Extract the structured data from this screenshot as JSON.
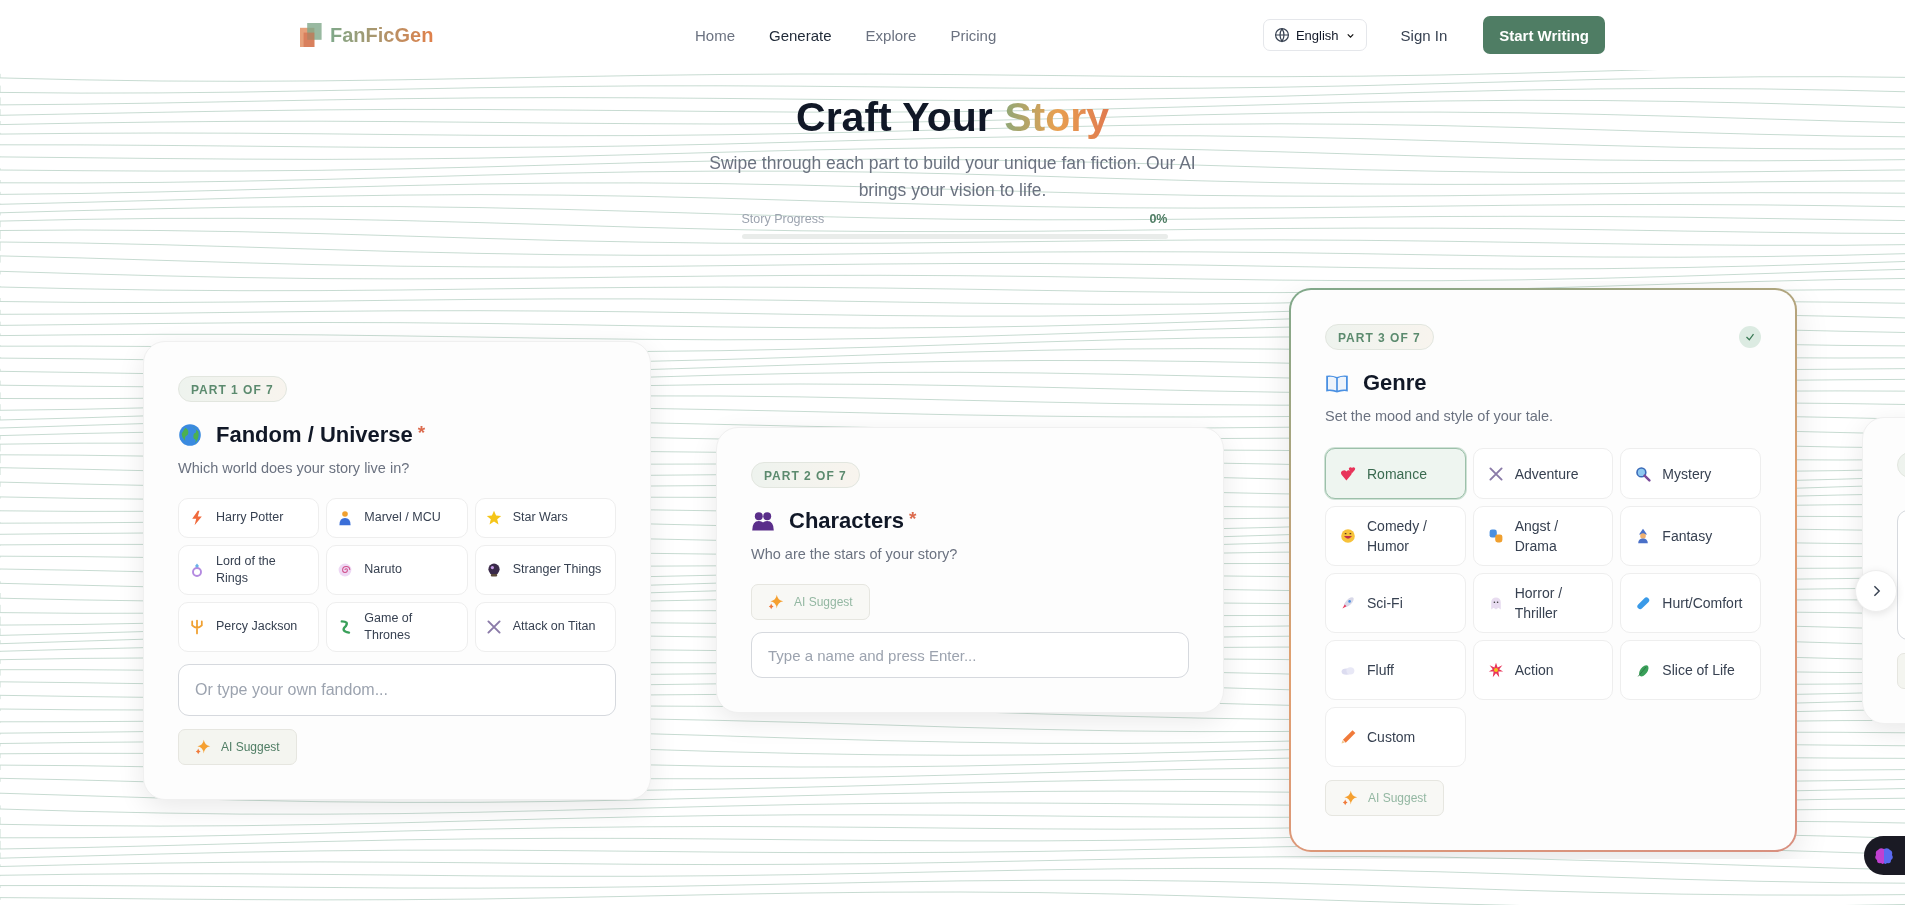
{
  "header": {
    "logo": "FanFicGen",
    "nav": [
      {
        "label": "Home",
        "selected": false
      },
      {
        "label": "Generate",
        "selected": true
      },
      {
        "label": "Explore",
        "selected": false
      },
      {
        "label": "Pricing",
        "selected": false
      }
    ],
    "language": "English",
    "sign_in": "Sign In",
    "cta": "Start Writing"
  },
  "hero": {
    "title": "Craft Your **Story**",
    "subtitle": "Swipe through each part to build your unique fan fiction. Our AI brings your vision to life.",
    "progress_label": "Story Progress",
    "progress_value": "0%",
    "level": 0
  },
  "cards": [
    {
      "part": "PART 1 OF 7",
      "title": "Fandom / Universe",
      "required_mark": "*",
      "active": false,
      "description": "Which world does your story live in?",
      "blocks": [
        {
          "kind": "options",
          "items": [
            {
              "label": "Harry Potter",
              "selected": false
            },
            {
              "label": "Marvel / MCU",
              "selected": false
            },
            {
              "label": "Star Wars",
              "selected": false
            },
            {
              "label": "Lord of the Rings",
              "selected": false
            },
            {
              "label": "Naruto",
              "selected": false
            },
            {
              "label": "Stranger Things",
              "selected": false
            },
            {
              "label": "Percy Jackson",
              "selected": false
            },
            {
              "label": "Game of Thrones",
              "selected": false
            },
            {
              "label": "Attack on Titan",
              "selected": false
            }
          ]
        },
        {
          "kind": "input",
          "placeholder": "Or type your own fandom..."
        },
        {
          "kind": "ai",
          "label": "AI Suggest",
          "disabled": false
        }
      ]
    },
    {
      "part": "PART 2 OF 7",
      "title": "Characters",
      "required_mark": "*",
      "active": false,
      "description": "Who are the stars of your story?",
      "blocks": [
        {
          "kind": "ai",
          "label": "AI Suggest",
          "disabled": true
        },
        {
          "kind": "input",
          "placeholder": "Type a name and press Enter..."
        }
      ]
    },
    {
      "part": "PART 3 OF 7",
      "title": "Genre",
      "completed": true,
      "active": true,
      "description": "Set the mood and style of your tale.",
      "blocks": [
        {
          "kind": "options",
          "items": [
            {
              "label": "Romance",
              "selected": true
            },
            {
              "label": "Adventure",
              "selected": false
            },
            {
              "label": "Mystery",
              "selected": false
            },
            {
              "label": "Comedy / Humor",
              "selected": false
            },
            {
              "label": "Angst / Drama",
              "selected": false
            },
            {
              "label": "Fantasy",
              "selected": false
            },
            {
              "label": "Sci-Fi",
              "selected": false
            },
            {
              "label": "Horror / Thriller",
              "selected": false
            },
            {
              "label": "Hurt/Comfort",
              "selected": false
            },
            {
              "label": "Fluff",
              "selected": false
            },
            {
              "label": "Action",
              "selected": false
            },
            {
              "label": "Slice of Life",
              "selected": false
            },
            {
              "label": "Custom",
              "selected": false
            }
          ]
        },
        {
          "kind": "ai",
          "label": "AI Suggest",
          "disabled": true
        }
      ]
    },
    {
      "active": false,
      "blocks": [
        {
          "kind": "textarea"
        },
        {
          "kind": "ai"
        }
      ]
    }
  ]
}
